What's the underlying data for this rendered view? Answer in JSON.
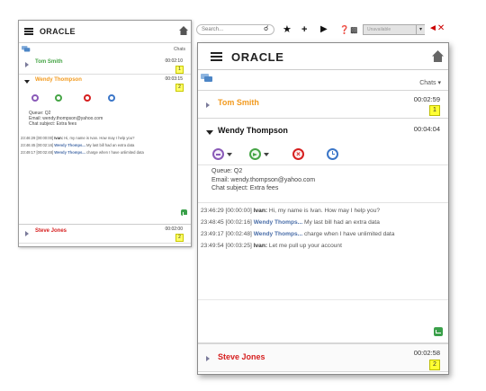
{
  "app": {
    "logo": "ORACLE",
    "chats_label": "Chats"
  },
  "toolbar": {
    "search_placeholder": "Search...",
    "status_value": "Unavailable"
  },
  "colors": {
    "orange": "#f29a1e",
    "green": "#46a546",
    "red": "#d61f1f",
    "blue": "#4a6ea9",
    "badge": "#ffff33"
  },
  "small": {
    "chats": [
      {
        "name": "Tom Smith",
        "time": "00:02:10",
        "badge": "1"
      },
      {
        "name": "Wendy Thompson",
        "time": "00:03:15",
        "badge": "2"
      },
      {
        "name": "Steve Jones",
        "time": "00:02:00",
        "badge": "2"
      }
    ],
    "info": {
      "queue": "Queue: Q2",
      "email": "Email: wendy.thompson@yahoo.com",
      "subject": "Chat subject: Extra fees"
    },
    "transcript": [
      {
        "ts": "23:46:29 [00:00:00]",
        "who": "Ivan:",
        "msg": "Hi, my name is Ivan. How may I help you?"
      },
      {
        "ts": "23:46:45 [00:02:16]",
        "who": "Wendy Thomps...",
        "msg": "My last bill had an extra data"
      },
      {
        "ts": "23:49:17 [00:02:48]",
        "who": "Wendy Thomps...",
        "msg": "charge when I have unlimited data"
      }
    ]
  },
  "large": {
    "chats": [
      {
        "name": "Tom Smith",
        "time": "00:02:59",
        "badge": "1"
      },
      {
        "name": "Wendy Thompson",
        "time": "00:04:04"
      },
      {
        "name": "Steve Jones",
        "time": "00:02:58",
        "badge": "2"
      }
    ],
    "info": {
      "queue": "Queue: Q2",
      "email": "Email: wendy.thompson@yahoo.com",
      "subject": "Chat subject: Extra fees"
    },
    "transcript": [
      {
        "ts": "23:46:29 [00:00:00]",
        "who": "Ivan:",
        "msg": "Hi, my name is Ivan. How may I help you?"
      },
      {
        "ts": "23:48:45 [00:02:16]",
        "who": "Wendy Thomps...",
        "msg": "My last bill had an extra data"
      },
      {
        "ts": "23:49:17 [00:02:48]",
        "who": "Wendy Thomps...",
        "msg": "charge when I have unlimited data"
      },
      {
        "ts": "23:49:54 [00:03:25]",
        "who": "Ivan:",
        "msg": "Let me pull up your account"
      }
    ]
  }
}
